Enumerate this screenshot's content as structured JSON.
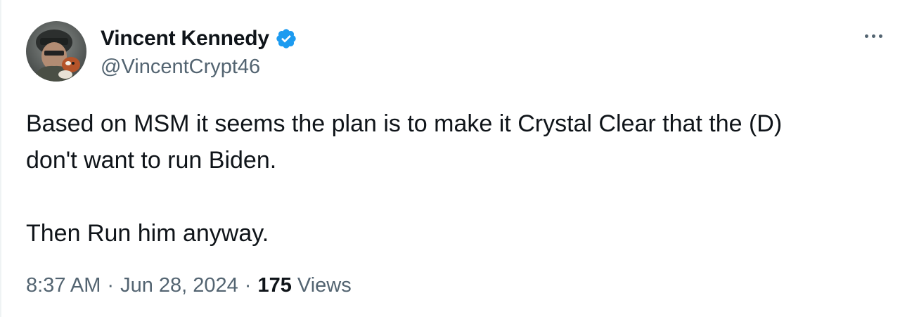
{
  "author": {
    "display_name": "Vincent Kennedy",
    "handle": "@VincentCrypt46",
    "verified": true
  },
  "tweet": {
    "lines": [
      "Based on MSM it seems the plan is to make it Crystal Clear that the (D)",
      "don't want to run Biden."
    ],
    "second_paragraph": "Then Run him anyway."
  },
  "meta": {
    "time": "8:37 AM",
    "separator": "·",
    "date": "Jun 28, 2024",
    "views_count": "175",
    "views_label": "Views"
  },
  "colors": {
    "verified_badge": "#1d9bf0",
    "secondary_text": "#536471",
    "primary_text": "#0f1419"
  },
  "icons": {
    "verified": "verified-badge-icon",
    "more": "more-horizontal-icon"
  }
}
